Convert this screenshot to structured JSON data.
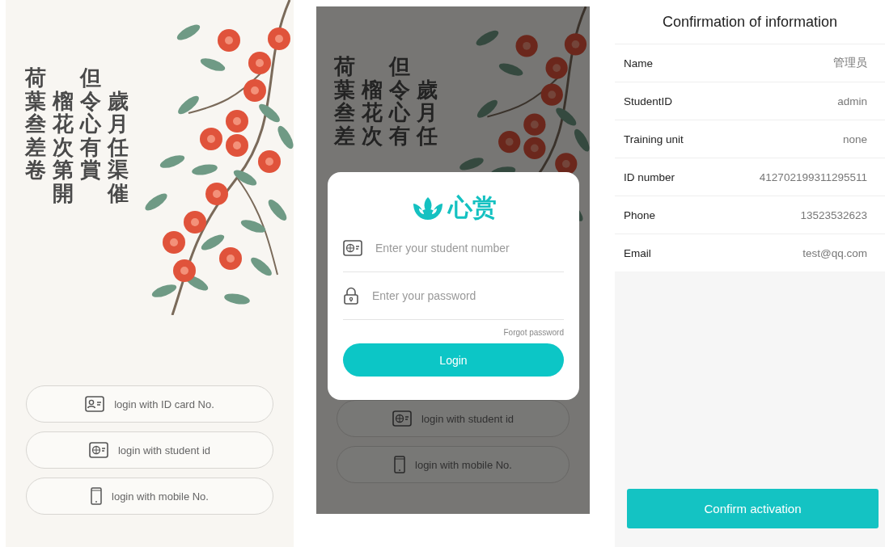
{
  "login_screen": {
    "poem_columns": [
      {
        "text": "荷葉叁差卷",
        "kind": "top"
      },
      {
        "text": "榴花次第開",
        "kind": "lowered"
      },
      {
        "text": "但令心有賞",
        "kind": "top"
      },
      {
        "text": "歲月任渠催",
        "kind": "lowered"
      }
    ],
    "login_options": [
      {
        "label": "login with ID card No.",
        "kind": "id_card"
      },
      {
        "label": "login with student id",
        "kind": "student"
      },
      {
        "label": "login with mobile No.",
        "kind": "mobile"
      }
    ]
  },
  "login_dialog_screen": {
    "poem_columns": [
      {
        "text": "荷葉叁差",
        "kind": "top"
      },
      {
        "text": "榴花次",
        "kind": "lowered"
      },
      {
        "text": "但令心有",
        "kind": "top"
      },
      {
        "text": "歲月任",
        "kind": "lowered"
      }
    ],
    "login_options": [
      {
        "label": "login with student id",
        "kind": "student"
      },
      {
        "label": "login with mobile No.",
        "kind": "mobile"
      }
    ],
    "dialog": {
      "logo_text": "心赏",
      "fields": [
        {
          "placeholder": "Enter your student number",
          "kind": "student"
        },
        {
          "placeholder": "Enter your password",
          "kind": "lock"
        }
      ],
      "forgot_link": "Forgot password",
      "login_button": "Login"
    }
  },
  "confirmation_screen": {
    "title": "Confirmation of information",
    "rows": [
      {
        "label": "Name",
        "value": "管理员"
      },
      {
        "label": "StudentID",
        "value": "admin"
      },
      {
        "label": "Training unit",
        "value": "none"
      },
      {
        "label": "ID number",
        "value": "412702199311295511"
      },
      {
        "label": "Phone",
        "value": "13523532623"
      },
      {
        "label": "Email",
        "value": "test@qq.com"
      }
    ],
    "confirm_button": "Confirm activation"
  }
}
